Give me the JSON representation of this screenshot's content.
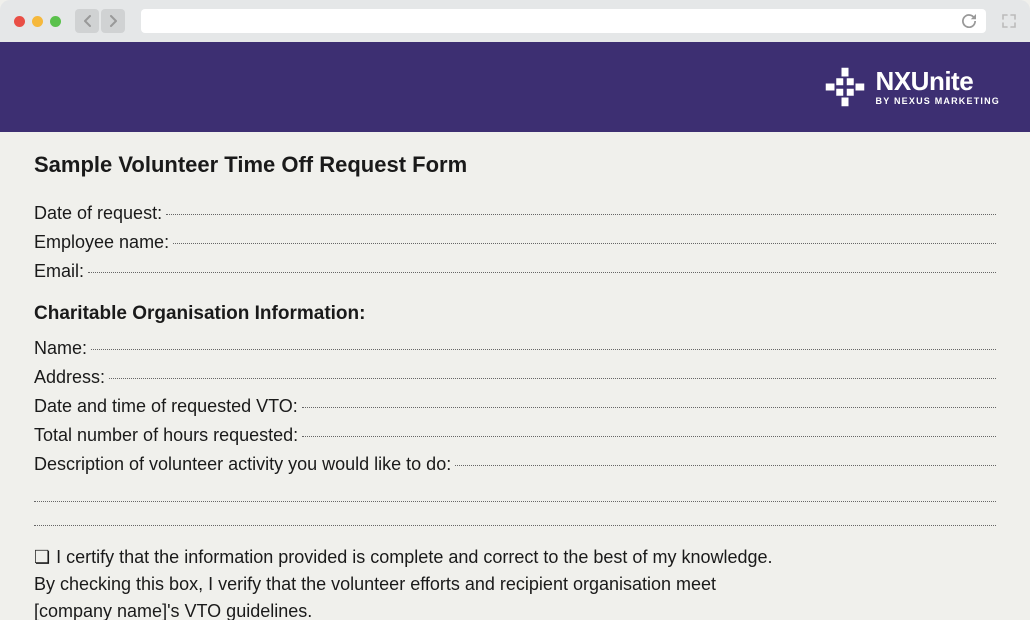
{
  "brand": {
    "name": "NXUnite",
    "byline": "BY NEXUS MARKETING"
  },
  "form": {
    "title": "Sample Volunteer Time Off Request Form",
    "top_fields": [
      {
        "label": "Date of request:"
      },
      {
        "label": "Employee name:"
      },
      {
        "label": "Email:"
      }
    ],
    "section_title": "Charitable Organisation Information:",
    "org_fields": [
      {
        "label": "Name:"
      },
      {
        "label": "Address:"
      },
      {
        "label": "Date and time of requested VTO:"
      },
      {
        "label": "Total number of hours requested:"
      },
      {
        "label": "Description of volunteer activity you would like to do:"
      }
    ],
    "certify_line1": "I certify that the information provided is complete and correct to the best of my knowledge.",
    "certify_line2": "By checking this box, I verify that the volunteer efforts and recipient organisation meet",
    "certify_line3": "[company name]'s VTO guidelines."
  }
}
